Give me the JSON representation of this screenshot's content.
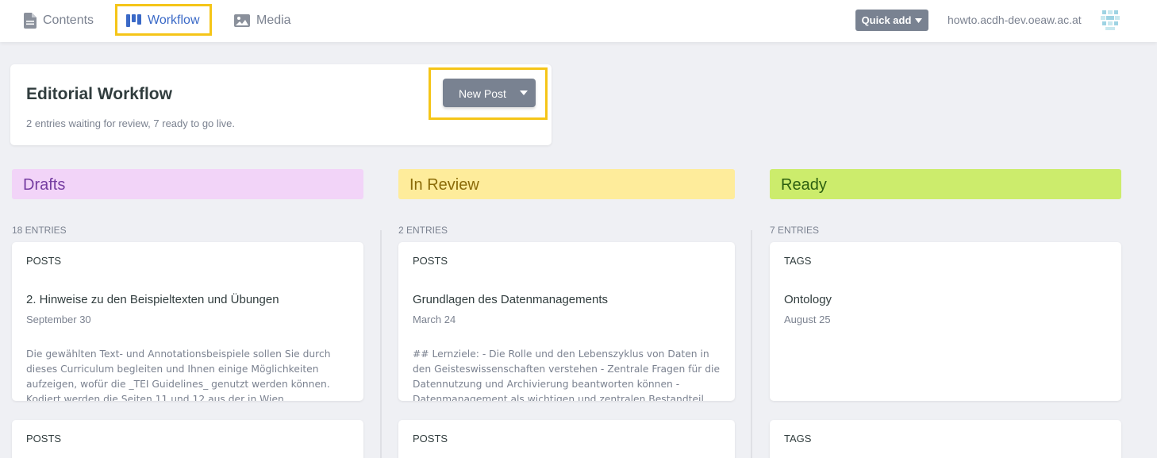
{
  "nav": {
    "contents_label": "Contents",
    "workflow_label": "Workflow",
    "media_label": "Media",
    "quick_add_label": "Quick add",
    "site_url": "howto.acdh-dev.oeaw.ac.at"
  },
  "header": {
    "title": "Editorial Workflow",
    "subtitle": "2 entries waiting for review, 7 ready to go live.",
    "new_post_label": "New Post"
  },
  "columns": [
    {
      "title": "Drafts",
      "entries_label": "18 ENTRIES",
      "cards": [
        {
          "collection": "POSTS",
          "title": "2. Hinweise zu den Beispieltexten und Übungen",
          "date": "September 30",
          "body": "Die gewählten Text- und Annotationsbeispiele sollen Sie durch dieses Curriculum begleiten und Ihnen einige Möglichkeiten aufzeigen, wofür die _TEI Guidelines_ genutzt werden können. Kodiert werden die Seiten 11 und 12 aus der in Wien erschienenen Zeitschrift „Die"
        },
        {
          "collection": "POSTS"
        }
      ]
    },
    {
      "title": "In Review",
      "entries_label": "2 ENTRIES",
      "cards": [
        {
          "collection": "POSTS",
          "title": "Grundlagen des Datenmanagements",
          "date": "March 24",
          "body": "## Lernziele: - Die Rolle und den Lebenszyklus von Daten in den Geisteswissenschaften verstehen - Zentrale Fragen für die Datennutzung und Archivierung beantworten können - Datenmanagement als wichtigen und zentralen Bestandteil der"
        },
        {
          "collection": "POSTS"
        }
      ]
    },
    {
      "title": "Ready",
      "entries_label": "7 ENTRIES",
      "cards": [
        {
          "collection": "TAGS",
          "title": "Ontology",
          "date": "August 25",
          "body": ""
        },
        {
          "collection": "TAGS"
        }
      ]
    }
  ],
  "colors": {
    "accent": "#3a69c7",
    "highlight": "#f5c518",
    "drafts": "#f2d4f8",
    "in_review": "#feec9b",
    "ready": "#ccec6c"
  }
}
